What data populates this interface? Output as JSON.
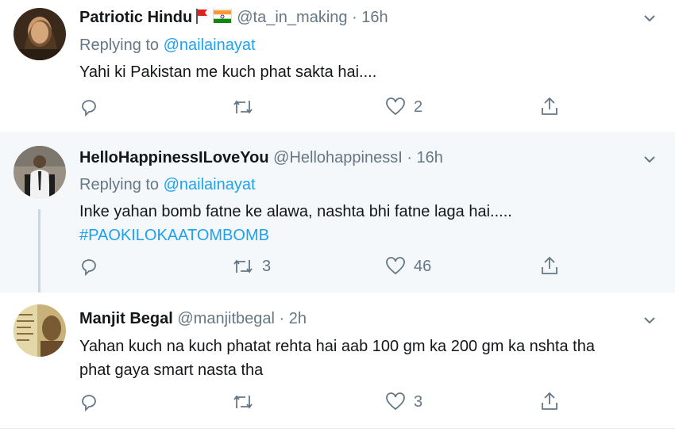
{
  "tweets": [
    {
      "display_name": "Patriotic Hindu",
      "name_icons": [
        "red-flag-emoji",
        "indian-flag-emoji"
      ],
      "handle": "@ta_in_making",
      "time": "· 16h",
      "reply_prefix": "Replying to",
      "reply_to": "@nailainayat",
      "text_lines": [
        "Yahi ki Pakistan me kuch phat sakta hai...."
      ],
      "hashtag": "",
      "actions": {
        "reply": "",
        "retweet": "",
        "like": "2"
      }
    },
    {
      "display_name": "HelloHappinessILoveYou",
      "handle": "@HellohappinessI",
      "time": "· 16h",
      "reply_prefix": "Replying to",
      "reply_to": "@nailainayat",
      "text_lines": [
        "Inke yahan bomb fatne ke alawa, nashta bhi fatne laga hai....."
      ],
      "hashtag": "#PAOKILOKAATOMBOMB",
      "actions": {
        "reply": "",
        "retweet": "3",
        "like": "46"
      }
    },
    {
      "display_name": "Manjit Begal",
      "handle": "@manjitbegal",
      "time": "· 2h",
      "reply_prefix": "",
      "reply_to": "",
      "text_lines": [
        "Yahan kuch na kuch phatat rehta hai aab 100 gm ka 200 gm ka nshta tha",
        "phat gaya smart nasta tha"
      ],
      "hashtag": "",
      "actions": {
        "reply": "",
        "retweet": "",
        "like": "3"
      }
    }
  ],
  "colors": {
    "link": "#1da1f2",
    "muted": "#657786",
    "text": "#14171a",
    "highlight_bg": "#f5f8fa"
  },
  "icons": [
    "reply-icon",
    "retweet-icon",
    "like-icon",
    "share-icon",
    "chevron-down-icon"
  ]
}
